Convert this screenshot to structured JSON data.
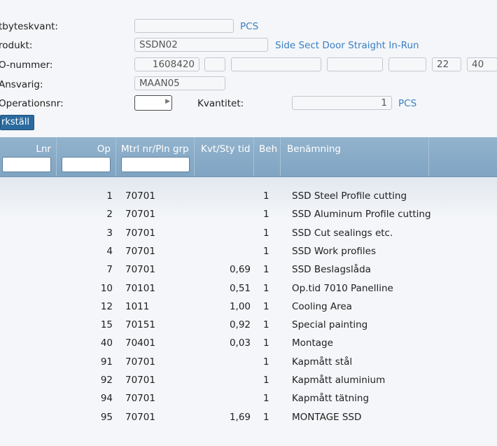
{
  "form": {
    "utbyteskvant": {
      "label": "tbyteskvant:",
      "value": "",
      "unit": "PCS"
    },
    "produkt": {
      "label": "rodukt:",
      "value": "SSDN02",
      "description": "Side Sect Door Straight In-Run"
    },
    "io_nummer": {
      "label": "O-nummer:",
      "value": "1608420",
      "f2": "",
      "f3": "",
      "f4": "",
      "f5": "",
      "f6": "22",
      "f7": "40"
    },
    "ansvarig": {
      "label": "Ansvarig:",
      "value": "MAAN05"
    },
    "operationsnr": {
      "label": "Operationsnr:",
      "value": ""
    },
    "kvantitet": {
      "label": "Kvantitet:",
      "value": "1",
      "unit": "PCS"
    },
    "execute_button": "rkställ"
  },
  "grid": {
    "headers": {
      "lnr": "Lnr",
      "op": "Op",
      "mtrl": "Mtrl nr/Pln grp",
      "kvt": "Kvt/Sty tid",
      "beh": "Beh",
      "benamning": "Benämning"
    },
    "rows": [
      {
        "op": "1",
        "mtrl": "70701",
        "kvt": "",
        "beh": "1",
        "ben": "SSD Steel Profile cutting"
      },
      {
        "op": "2",
        "mtrl": "70701",
        "kvt": "",
        "beh": "1",
        "ben": "SSD Aluminum Profile cutting"
      },
      {
        "op": "3",
        "mtrl": "70701",
        "kvt": "",
        "beh": "1",
        "ben": "SSD Cut sealings etc."
      },
      {
        "op": "4",
        "mtrl": "70701",
        "kvt": "",
        "beh": "1",
        "ben": "SSD Work profiles"
      },
      {
        "op": "7",
        "mtrl": "70701",
        "kvt": "0,69",
        "beh": "1",
        "ben": "SSD Beslagslåda"
      },
      {
        "op": "10",
        "mtrl": "70101",
        "kvt": "0,51",
        "beh": "1",
        "ben": "Op.tid 7010 Panelline"
      },
      {
        "op": "12",
        "mtrl": "1011",
        "kvt": "1,00",
        "beh": "1",
        "ben": "Cooling Area"
      },
      {
        "op": "15",
        "mtrl": "70151",
        "kvt": "0,92",
        "beh": "1",
        "ben": "Special painting"
      },
      {
        "op": "40",
        "mtrl": "70401",
        "kvt": "0,03",
        "beh": "1",
        "ben": "Montage"
      },
      {
        "op": "91",
        "mtrl": "70701",
        "kvt": "",
        "beh": "1",
        "ben": "Kapmått stål"
      },
      {
        "op": "92",
        "mtrl": "70701",
        "kvt": "",
        "beh": "1",
        "ben": "Kapmått aluminium"
      },
      {
        "op": "94",
        "mtrl": "70701",
        "kvt": "",
        "beh": "1",
        "ben": "Kapmått tätning"
      },
      {
        "op": "95",
        "mtrl": "70701",
        "kvt": "1,69",
        "beh": "1",
        "ben": "MONTAGE SSD"
      }
    ]
  },
  "colors": {
    "accent": "#3a7fc2",
    "header": "#88abc8",
    "button": "#2b6a9e"
  }
}
